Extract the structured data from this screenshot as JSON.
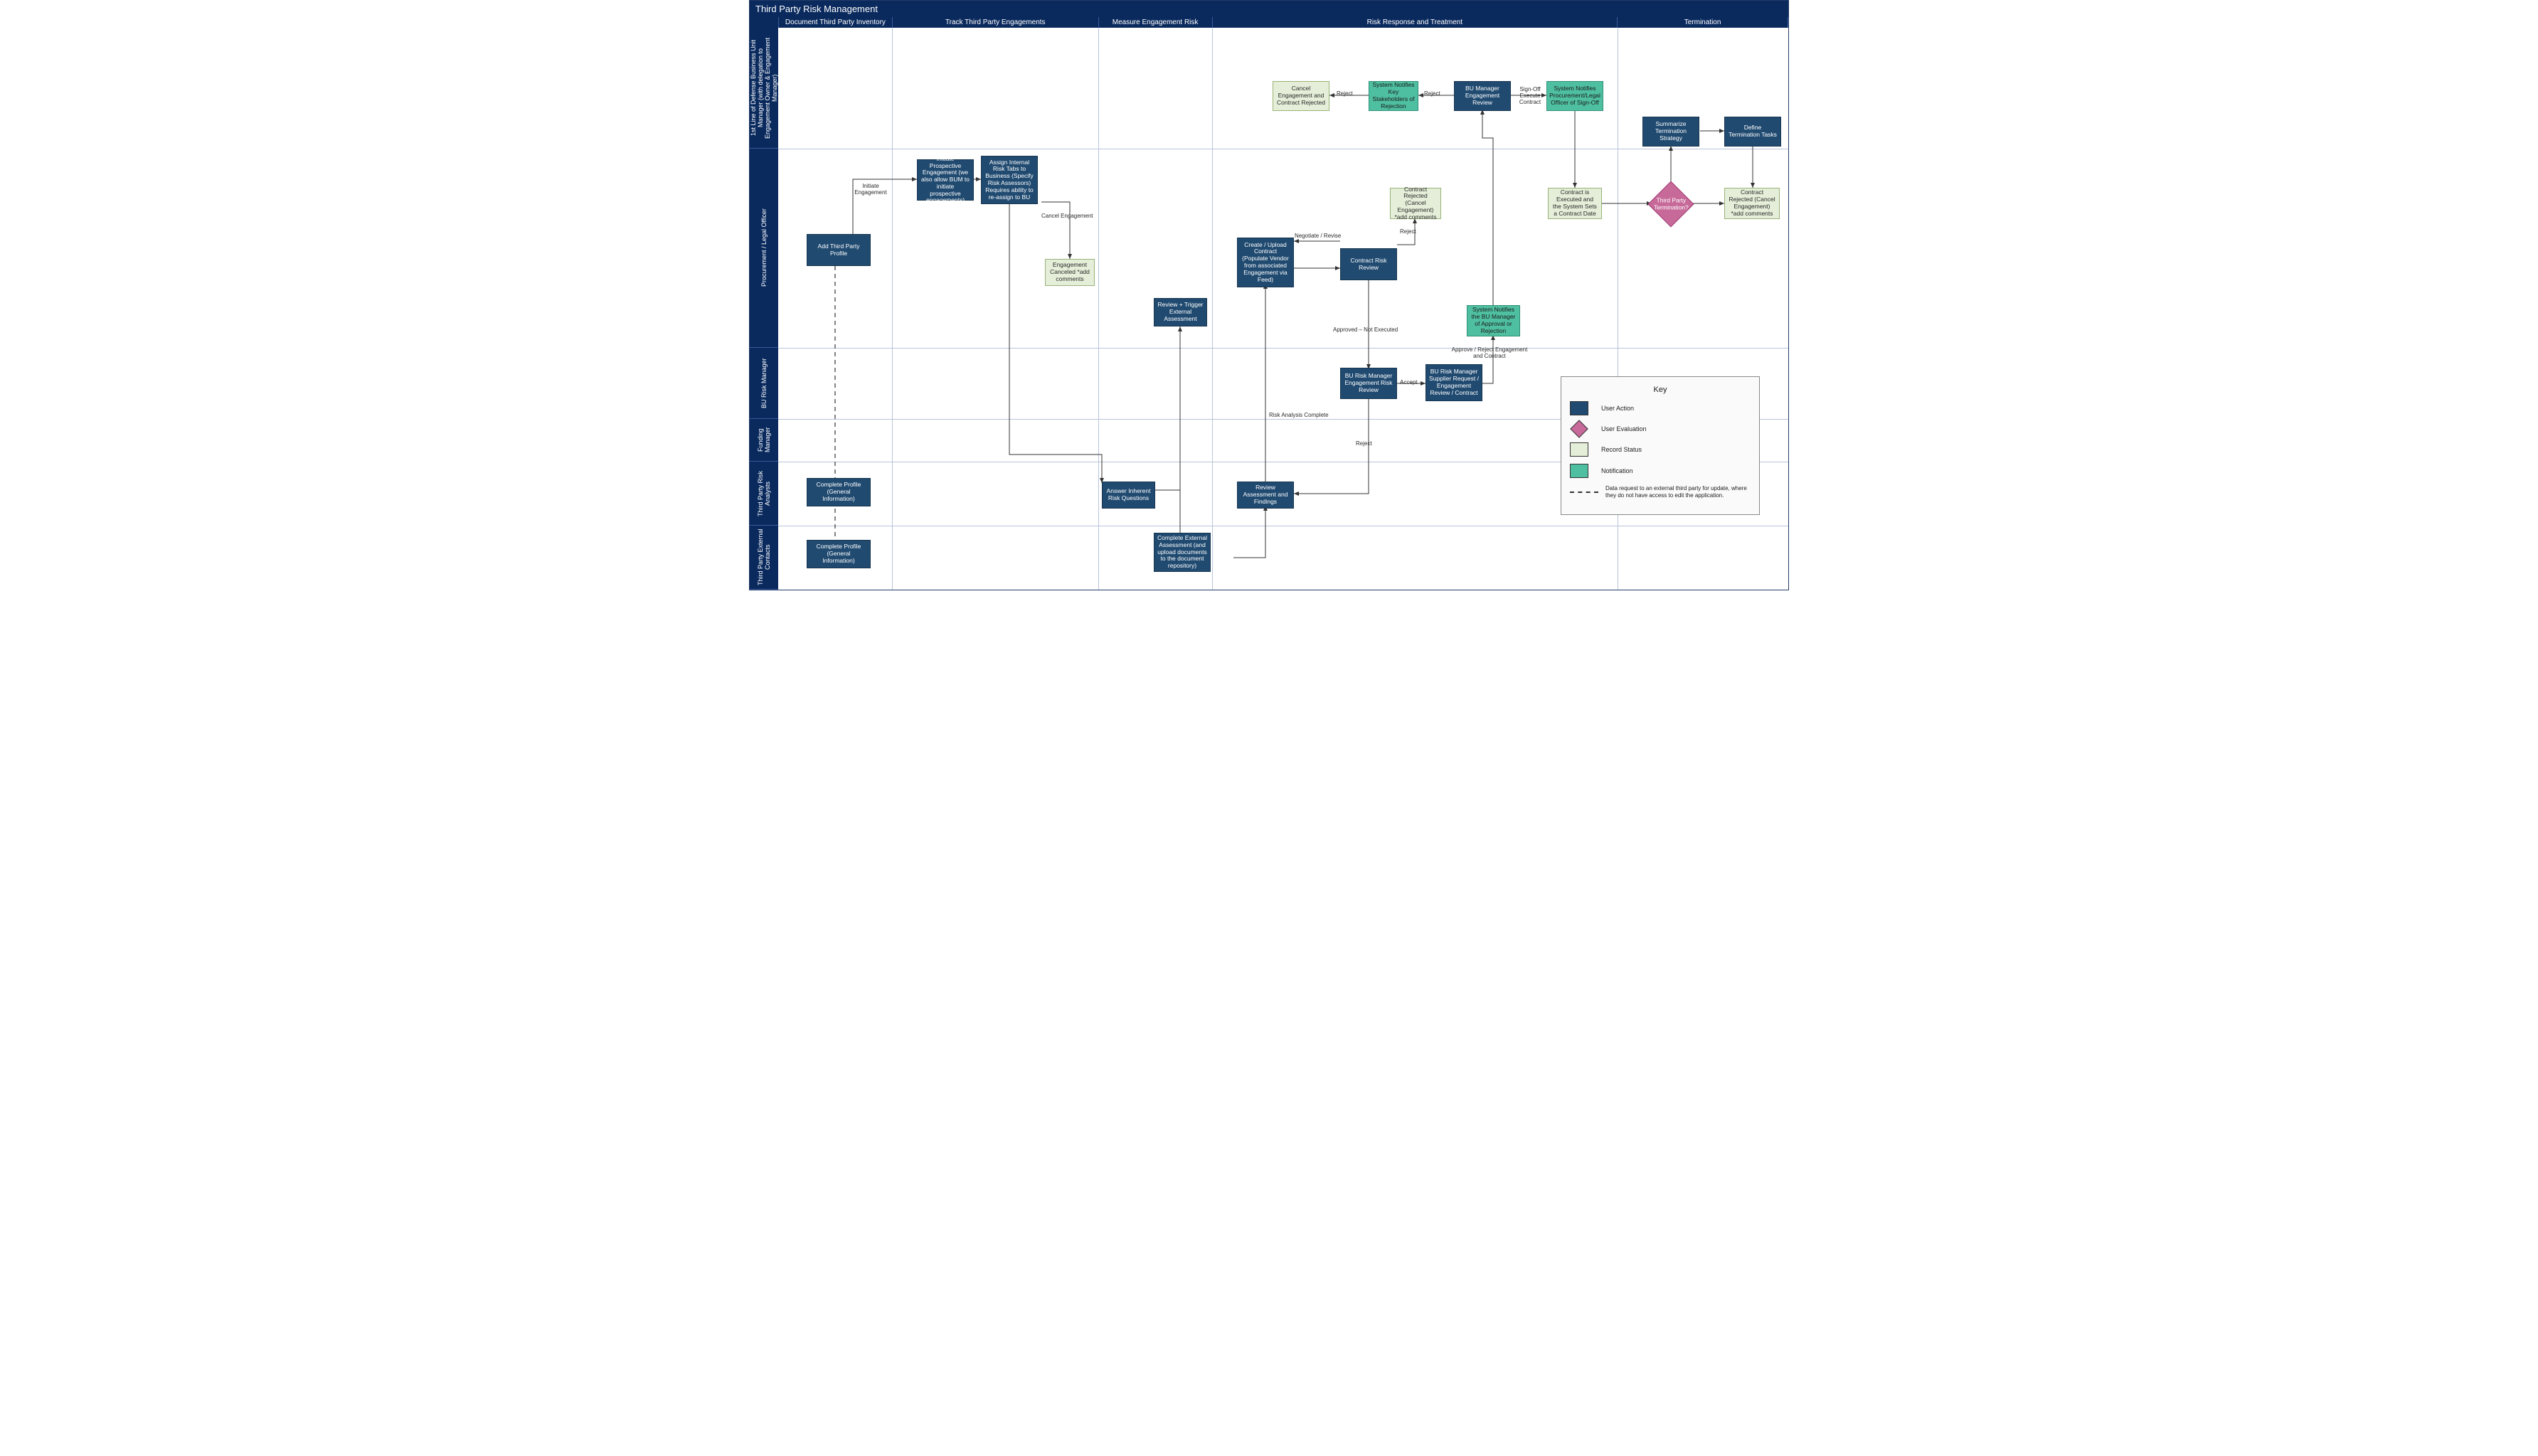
{
  "title": "Third Party Risk Management",
  "columns": [
    "Document Third Party Inventory",
    "Track Third Party Engagements",
    "Measure Engagement Risk",
    "Risk Response and Treatment",
    "Termination"
  ],
  "lanes": [
    "1st Line of Defense Business Unit Manager (with delegation to Engagement Owner & Engagement Manager)",
    "Procurement / Legal Officer",
    "BU Risk Manager",
    "Funding Manager",
    "Third Party  Risk Analysts",
    "Third Party External Contacts"
  ],
  "boxes": {
    "addProfile": "Add Third Party Profile",
    "initiateEng": "Initiate Prospective Engagement (we also allow BUM to initiate prospective engagements)",
    "assignTabs": "Assign Internal Risk Tabs to Business (Specify Risk Assessors) Requires ability to re-assign to BU",
    "engCanceled": "Engagement Canceled *add comments",
    "reviewTrigger": "Review + Trigger External Assessment",
    "answerInherent": "Answer Inherent Risk Questions",
    "completeExternal": "Complete External Assessment (and upload documents to the document repository)",
    "reviewFindings": "Review Assessment and Findings",
    "createContract": "Create / Upload Contract\n(Populate Vendor from associated Engagement via Feed)",
    "contractReview": "Contract Risk Review",
    "contractRejected": "Contract Rejected (Cancel Engagement) *add comments",
    "buRiskReview": "BU Risk Manager Engagement Risk Review",
    "buRiskSupplier": "BU Risk Manager Supplier Request / Engagement Review / Contract",
    "notifiesManager": "System Notifies the BU Manager of Approval or Rejection",
    "buManagerReview": "BU Manager Engagement Review",
    "notifiesLegal": "System Notifies Procurement/Legal Officer of Sign-Off",
    "notifiesStakeholders": "System Notifies Key Stakeholders of Rejection",
    "cancelEngContract": "Cancel Engagement and Contract Rejected",
    "contractExecuted": "Contract is Executed and the System Sets a Contract Date",
    "termination": "Third Party Termination?",
    "summarize": "Summarize Termination Strategy",
    "defineTasks": "Define Termination Tasks",
    "contractRejected2": "Contract Rejected (Cancel Engagement) *add comments",
    "completeProfile1": "Complete Profile (General Information)",
    "completeProfile2": "Complete Profile (General Information)"
  },
  "labels": {
    "initiateEngL": "Initiate Engagement",
    "cancelEngL": "Cancel Engagement",
    "riskComplete": "Risk Analysis Complete",
    "negotiate": "Negotiate / Revise",
    "approvedNot": "Approved – Not Executed",
    "rejectL": "Reject",
    "accept": "Accept",
    "approveReject": "Approve / Reject Engagement and Contract",
    "signOff": "Sign-Off Execute Contract",
    "reject2": "Reject",
    "reject3": "Reject"
  },
  "key": {
    "title": "Key",
    "ua": "User Action",
    "ev": "User Evaluation",
    "rs": "Record Status",
    "nt": "Notification",
    "dash": "Data request to an external third party for update, where they do not have access to edit the application."
  },
  "colors": {
    "userAction": "#204a70",
    "evaluation": "#c76a9a",
    "recordStatus": "#e4eed8",
    "notification": "#4fbfa1",
    "header": "#0a2a5e"
  },
  "chart_data": {
    "type": "swimlane-flowchart",
    "title": "Third Party Risk Management",
    "phases": [
      "Document Third Party Inventory",
      "Track Third Party Engagements",
      "Measure Engagement Risk",
      "Risk Response and Treatment",
      "Termination"
    ],
    "lanes": [
      "1st Line of Defense Business Unit Manager",
      "Procurement / Legal Officer",
      "BU Risk Manager",
      "Funding Manager",
      "Third Party Risk Analysts",
      "Third Party External Contacts"
    ],
    "nodes": [
      {
        "id": "addProfile",
        "lane": 1,
        "phase": 0,
        "type": "userAction",
        "label": "Add Third Party Profile"
      },
      {
        "id": "completeProfile1",
        "lane": 4,
        "phase": 0,
        "type": "userAction",
        "label": "Complete Profile (General Information)"
      },
      {
        "id": "completeProfile2",
        "lane": 5,
        "phase": 0,
        "type": "userAction",
        "label": "Complete Profile (General Information)"
      },
      {
        "id": "initiateEng",
        "lane": 1,
        "phase": 1,
        "type": "userAction",
        "label": "Initiate Prospective Engagement"
      },
      {
        "id": "assignTabs",
        "lane": 1,
        "phase": 1,
        "type": "userAction",
        "label": "Assign Internal Risk Tabs to Business"
      },
      {
        "id": "engCanceled",
        "lane": 1,
        "phase": 1,
        "type": "recordStatus",
        "label": "Engagement Canceled *add comments"
      },
      {
        "id": "answerInherent",
        "lane": 4,
        "phase": 1,
        "type": "userAction",
        "label": "Answer Inherent Risk Questions"
      },
      {
        "id": "reviewTrigger",
        "lane": 1,
        "phase": 2,
        "type": "userAction",
        "label": "Review + Trigger External Assessment"
      },
      {
        "id": "completeExternal",
        "lane": 5,
        "phase": 2,
        "type": "userAction",
        "label": "Complete External Assessment"
      },
      {
        "id": "reviewFindings",
        "lane": 4,
        "phase": 2,
        "type": "userAction",
        "label": "Review Assessment and Findings"
      },
      {
        "id": "createContract",
        "lane": 1,
        "phase": 2,
        "type": "userAction",
        "label": "Create / Upload Contract"
      },
      {
        "id": "contractReview",
        "lane": 1,
        "phase": 2,
        "type": "userAction",
        "label": "Contract Risk Review"
      },
      {
        "id": "contractRejected",
        "lane": 1,
        "phase": 2,
        "type": "recordStatus",
        "label": "Contract Rejected (Cancel Engagement)"
      },
      {
        "id": "buRiskReview",
        "lane": 2,
        "phase": 2,
        "type": "userAction",
        "label": "BU Risk Manager Engagement Risk Review"
      },
      {
        "id": "buRiskSupplier",
        "lane": 2,
        "phase": 2,
        "type": "userAction",
        "label": "BU Risk Manager Supplier Request / Engagement Review / Contract"
      },
      {
        "id": "notifiesManager",
        "lane": 1,
        "phase": 3,
        "type": "notification",
        "label": "System Notifies the BU Manager of Approval or Rejection"
      },
      {
        "id": "buManagerReview",
        "lane": 0,
        "phase": 3,
        "type": "userAction",
        "label": "BU Manager Engagement Review"
      },
      {
        "id": "notifiesLegal",
        "lane": 0,
        "phase": 3,
        "type": "notification",
        "label": "System Notifies Procurement/Legal Officer of Sign-Off"
      },
      {
        "id": "notifiesStakeholders",
        "lane": 0,
        "phase": 3,
        "type": "notification",
        "label": "System Notifies Key Stakeholders of Rejection"
      },
      {
        "id": "cancelEngContract",
        "lane": 0,
        "phase": 3,
        "type": "recordStatus",
        "label": "Cancel Engagement and Contract Rejected"
      },
      {
        "id": "contractExecuted",
        "lane": 1,
        "phase": 3,
        "type": "recordStatus",
        "label": "Contract is Executed and the System Sets a Contract Date"
      },
      {
        "id": "termination",
        "lane": 1,
        "phase": 4,
        "type": "evaluation",
        "label": "Third Party Termination?"
      },
      {
        "id": "summarize",
        "lane": 0,
        "phase": 4,
        "type": "userAction",
        "label": "Summarize Termination Strategy"
      },
      {
        "id": "defineTasks",
        "lane": 0,
        "phase": 4,
        "type": "userAction",
        "label": "Define Termination Tasks"
      },
      {
        "id": "contractRejected2",
        "lane": 1,
        "phase": 4,
        "type": "recordStatus",
        "label": "Contract Rejected (Cancel Engagement)"
      }
    ],
    "edges": [
      {
        "from": "addProfile",
        "to": "initiateEng",
        "label": "Initiate Engagement"
      },
      {
        "from": "addProfile",
        "to": "completeProfile1",
        "style": "dashed"
      },
      {
        "from": "addProfile",
        "to": "completeProfile2",
        "style": "dashed"
      },
      {
        "from": "initiateEng",
        "to": "assignTabs"
      },
      {
        "from": "assignTabs",
        "to": "engCanceled",
        "label": "Cancel Engagement"
      },
      {
        "from": "assignTabs",
        "to": "answerInherent"
      },
      {
        "from": "answerInherent",
        "to": "reviewTrigger"
      },
      {
        "from": "reviewTrigger",
        "to": "completeExternal"
      },
      {
        "from": "completeExternal",
        "to": "reviewFindings"
      },
      {
        "from": "reviewFindings",
        "to": "createContract",
        "label": "Risk Analysis Complete"
      },
      {
        "from": "createContract",
        "to": "contractReview"
      },
      {
        "from": "contractReview",
        "to": "createContract",
        "label": "Negotiate / Revise"
      },
      {
        "from": "contractReview",
        "to": "contractRejected",
        "label": "Reject"
      },
      {
        "from": "contractReview",
        "to": "buRiskReview",
        "label": "Approved – Not Executed"
      },
      {
        "from": "buRiskReview",
        "to": "buRiskSupplier",
        "label": "Accept"
      },
      {
        "from": "buRiskReview",
        "to": "reviewFindings",
        "label": "Reject"
      },
      {
        "from": "buRiskSupplier",
        "to": "notifiesManager",
        "label": "Approve / Reject Engagement and Contract"
      },
      {
        "from": "notifiesManager",
        "to": "buManagerReview"
      },
      {
        "from": "buManagerReview",
        "to": "notifiesLegal",
        "label": "Sign-Off Execute Contract"
      },
      {
        "from": "buManagerReview",
        "to": "notifiesStakeholders",
        "label": "Reject"
      },
      {
        "from": "notifiesStakeholders",
        "to": "cancelEngContract",
        "label": "Reject"
      },
      {
        "from": "notifiesLegal",
        "to": "contractExecuted"
      },
      {
        "from": "contractExecuted",
        "to": "termination"
      },
      {
        "from": "termination",
        "to": "summarize"
      },
      {
        "from": "termination",
        "to": "contractRejected2"
      },
      {
        "from": "summarize",
        "to": "defineTasks"
      },
      {
        "from": "defineTasks",
        "to": "contractRejected2"
      }
    ]
  }
}
